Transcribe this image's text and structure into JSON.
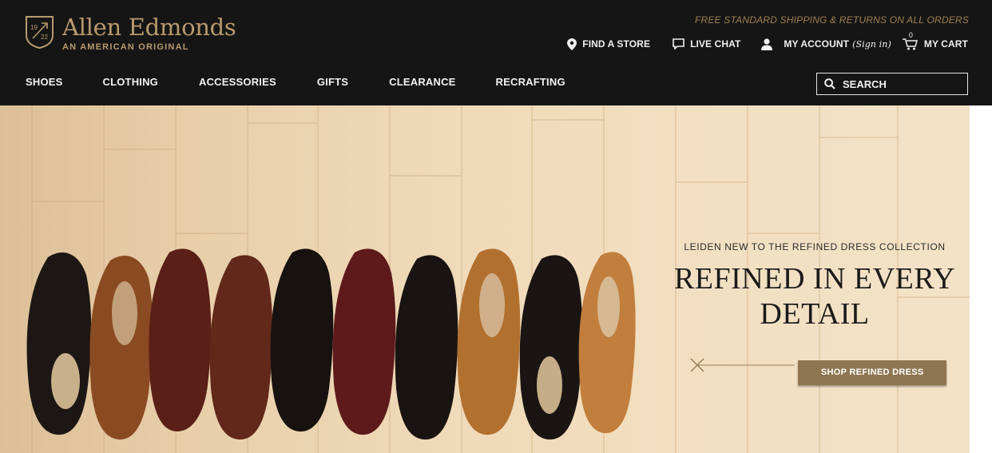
{
  "header": {
    "logo": {
      "name": "Allen Edmonds",
      "tagline": "AN AMERICAN ORIGINAL",
      "badge_top": "19",
      "badge_bottom": "22"
    },
    "promo": "FREE STANDARD SHIPPING & RETURNS ON ALL ORDERS",
    "utility": {
      "find_store": "FIND A STORE",
      "live_chat": "LIVE CHAT",
      "account": "MY ACCOUNT",
      "sign_in": "(Sign in)",
      "cart_count": "0",
      "cart": "MY CART"
    },
    "nav": [
      "SHOES",
      "CLOTHING",
      "ACCESSORIES",
      "GIFTS",
      "CLEARANCE",
      "RECRAFTING"
    ],
    "search": {
      "placeholder": "SEARCH"
    }
  },
  "hero": {
    "eyebrow": "LEIDEN NEW TO THE REFINED DRESS COLLECTION",
    "headline_line1": "REFINED IN EVERY",
    "headline_line2": "DETAIL",
    "cta": "SHOP REFINED DRESS"
  },
  "colors": {
    "header_bg": "#151515",
    "brand_gold": "#b89a6e",
    "promo_gold": "#a08152",
    "cta_bg": "#8e7651",
    "headline": "#1b1b1b"
  },
  "icons": [
    "map-pin-icon",
    "chat-bubble-icon",
    "user-icon",
    "cart-icon",
    "search-icon",
    "logo-badge-icon",
    "crossed-divider-icon"
  ]
}
